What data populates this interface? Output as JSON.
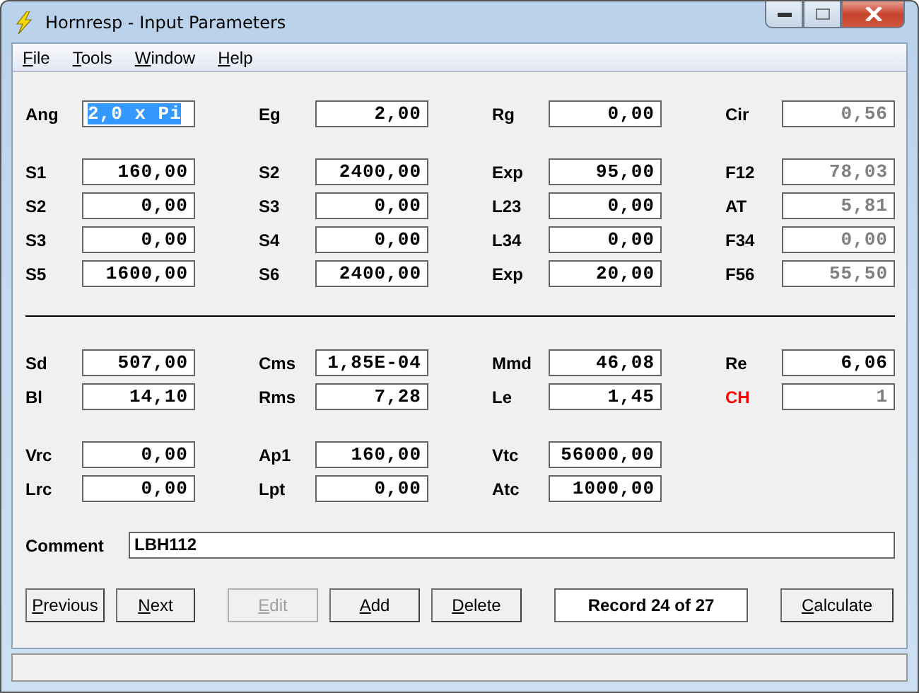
{
  "window": {
    "title": "Hornresp - Input Parameters"
  },
  "menu": [
    {
      "label": "File"
    },
    {
      "label": "Tools"
    },
    {
      "label": "Window"
    },
    {
      "label": "Help"
    }
  ],
  "sections": [
    {
      "groups": [
        {
          "rows": [
            [
              {
                "label": "Ang",
                "value": "2,0 x Pi",
                "selected": true,
                "disabled": false,
                "alert": false
              },
              {
                "label": "Eg",
                "value": "2,00",
                "selected": false,
                "disabled": false,
                "alert": false
              },
              {
                "label": "Rg",
                "value": "0,00",
                "selected": false,
                "disabled": false,
                "alert": false
              },
              {
                "label": "Cir",
                "value": "0,56",
                "selected": false,
                "disabled": true,
                "alert": false
              }
            ]
          ]
        },
        {
          "rows": [
            [
              {
                "label": "S1",
                "value": "160,00",
                "selected": false,
                "disabled": false,
                "alert": false
              },
              {
                "label": "S2",
                "value": "2400,00",
                "selected": false,
                "disabled": false,
                "alert": false
              },
              {
                "label": "Exp",
                "value": "95,00",
                "selected": false,
                "disabled": false,
                "alert": false
              },
              {
                "label": "F12",
                "value": "78,03",
                "selected": false,
                "disabled": true,
                "alert": false
              }
            ],
            [
              {
                "label": "S2",
                "value": "0,00",
                "selected": false,
                "disabled": false,
                "alert": false
              },
              {
                "label": "S3",
                "value": "0,00",
                "selected": false,
                "disabled": false,
                "alert": false
              },
              {
                "label": "L23",
                "value": "0,00",
                "selected": false,
                "disabled": false,
                "alert": false
              },
              {
                "label": "AT",
                "value": "5,81",
                "selected": false,
                "disabled": true,
                "alert": false
              }
            ],
            [
              {
                "label": "S3",
                "value": "0,00",
                "selected": false,
                "disabled": false,
                "alert": false
              },
              {
                "label": "S4",
                "value": "0,00",
                "selected": false,
                "disabled": false,
                "alert": false
              },
              {
                "label": "L34",
                "value": "0,00",
                "selected": false,
                "disabled": false,
                "alert": false
              },
              {
                "label": "F34",
                "value": "0,00",
                "selected": false,
                "disabled": true,
                "alert": false
              }
            ],
            [
              {
                "label": "S5",
                "value": "1600,00",
                "selected": false,
                "disabled": false,
                "alert": false
              },
              {
                "label": "S6",
                "value": "2400,00",
                "selected": false,
                "disabled": false,
                "alert": false
              },
              {
                "label": "Exp",
                "value": "20,00",
                "selected": false,
                "disabled": false,
                "alert": false
              },
              {
                "label": "F56",
                "value": "55,50",
                "selected": false,
                "disabled": true,
                "alert": false
              }
            ]
          ]
        }
      ]
    },
    {
      "groups": [
        {
          "rows": [
            [
              {
                "label": "Sd",
                "value": "507,00",
                "selected": false,
                "disabled": false,
                "alert": false
              },
              {
                "label": "Cms",
                "value": "1,85E-04",
                "selected": false,
                "disabled": false,
                "alert": false
              },
              {
                "label": "Mmd",
                "value": "46,08",
                "selected": false,
                "disabled": false,
                "alert": false
              },
              {
                "label": "Re",
                "value": "6,06",
                "selected": false,
                "disabled": false,
                "alert": false
              }
            ],
            [
              {
                "label": "Bl",
                "value": "14,10",
                "selected": false,
                "disabled": false,
                "alert": false
              },
              {
                "label": "Rms",
                "value": "7,28",
                "selected": false,
                "disabled": false,
                "alert": false
              },
              {
                "label": "Le",
                "value": "1,45",
                "selected": false,
                "disabled": false,
                "alert": false
              },
              {
                "label": "CH",
                "value": "1",
                "selected": false,
                "disabled": true,
                "alert": true
              }
            ]
          ]
        },
        {
          "rows": [
            [
              {
                "label": "Vrc",
                "value": "0,00",
                "selected": false,
                "disabled": false,
                "alert": false
              },
              {
                "label": "Ap1",
                "value": "160,00",
                "selected": false,
                "disabled": false,
                "alert": false
              },
              {
                "label": "Vtc",
                "value": "56000,00",
                "selected": false,
                "disabled": false,
                "alert": false
              }
            ],
            [
              {
                "label": "Lrc",
                "value": "0,00",
                "selected": false,
                "disabled": false,
                "alert": false
              },
              {
                "label": "Lpt",
                "value": "0,00",
                "selected": false,
                "disabled": false,
                "alert": false
              },
              {
                "label": "Atc",
                "value": "1000,00",
                "selected": false,
                "disabled": false,
                "alert": false
              }
            ]
          ]
        }
      ]
    }
  ],
  "comment": {
    "label": "Comment",
    "value": "LBH112"
  },
  "toolbar": [
    [
      {
        "kind": "button",
        "label": "Previous",
        "disabled": false
      },
      {
        "kind": "button",
        "label": "Next",
        "disabled": false
      }
    ],
    [
      {
        "kind": "button",
        "label": "Edit",
        "disabled": true
      },
      {
        "kind": "button",
        "label": "Add",
        "disabled": false
      },
      {
        "kind": "button",
        "label": "Delete",
        "disabled": false
      }
    ],
    [
      {
        "kind": "display",
        "label": "Record 24 of 27"
      }
    ],
    [
      {
        "kind": "button",
        "label": "Calculate",
        "disabled": false
      }
    ]
  ]
}
